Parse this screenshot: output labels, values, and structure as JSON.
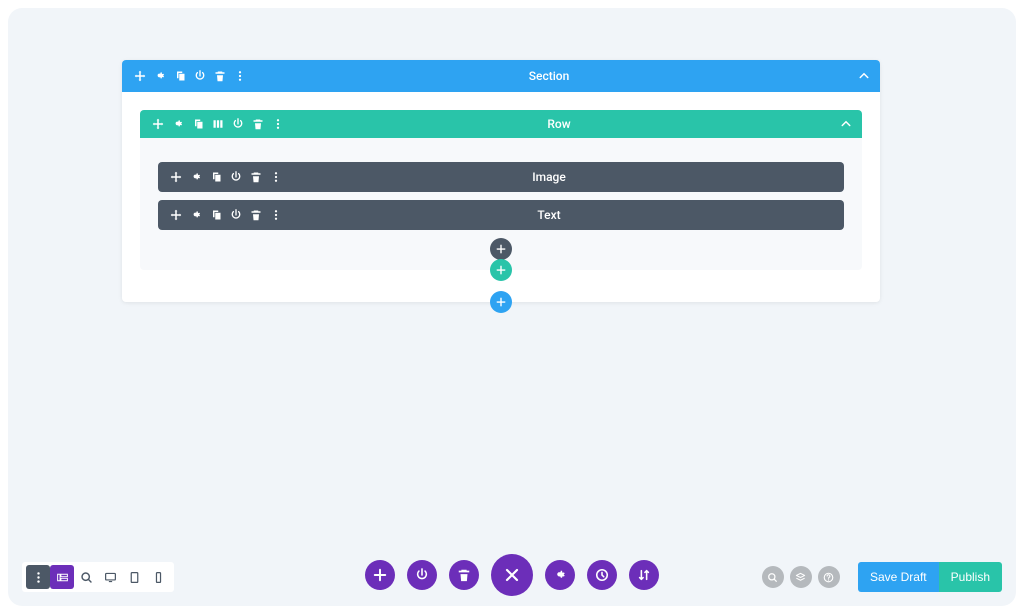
{
  "section": {
    "label": "Section",
    "row": {
      "label": "Row",
      "modules": [
        {
          "label": "Image"
        },
        {
          "label": "Text"
        }
      ]
    }
  },
  "actions": {
    "save_draft": "Save Draft",
    "publish": "Publish"
  },
  "colors": {
    "section": "#2ea3f2",
    "row": "#29c4a9",
    "module": "#4c5866",
    "accent": "#6c2eb9"
  }
}
